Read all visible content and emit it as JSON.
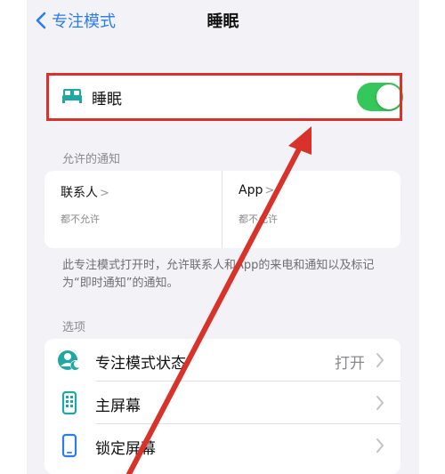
{
  "nav": {
    "back_label": "专注模式",
    "title": "睡眠"
  },
  "sleep_row": {
    "icon": "bed-icon",
    "label": "睡眠",
    "toggle_on": true
  },
  "allowed": {
    "header": "允许的通知",
    "people": {
      "title": "联系人",
      "subtitle": "都不允许"
    },
    "apps": {
      "title": "App",
      "subtitle": "都不允许"
    },
    "footnote": "此专注模式打开时，允许联系人和App的来电和通知以及标记为“即时通知”的通知。"
  },
  "options": {
    "header": "选项",
    "items": [
      {
        "label": "专注模式状态",
        "value": "打开",
        "icon": "focus-status-icon"
      },
      {
        "label": "主屏幕",
        "value": "",
        "icon": "home-screen-icon"
      },
      {
        "label": "锁定屏幕",
        "value": "",
        "icon": "lock-screen-icon"
      }
    ]
  },
  "colors": {
    "accent_blue": "#2a7bf6",
    "toggle_green": "#34c759",
    "annotation_red": "#d8322b",
    "icon_teal": "#1fa7a3"
  }
}
